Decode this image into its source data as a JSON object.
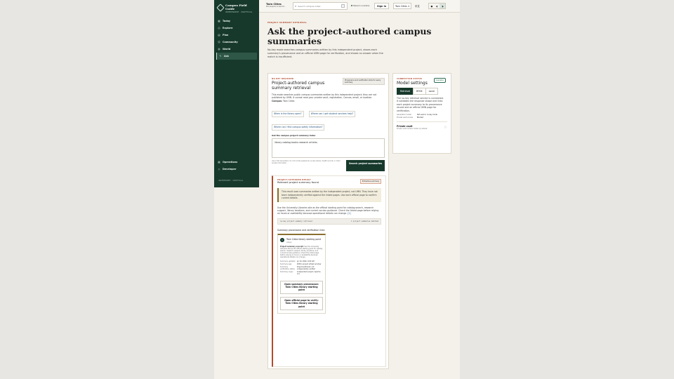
{
  "brand": {
    "name": "Campus Field Guide",
    "sub": "INDEPENDENT · UNOFFICIAL"
  },
  "nav": [
    {
      "label": "Today",
      "icon": "grid-icon"
    },
    {
      "label": "Explore",
      "icon": "compass-icon"
    },
    {
      "label": "Plan",
      "icon": "calendar-icon"
    },
    {
      "label": "Community",
      "icon": "people-icon"
    },
    {
      "label": "World",
      "icon": "globe-icon"
    },
    {
      "label": "Ask",
      "icon": "pen-icon"
    }
  ],
  "nav_secondary": [
    {
      "label": "Operations",
      "icon": "grid-icon"
    },
    {
      "label": "Developer",
      "icon": "diamond-icon"
    }
  ],
  "sidebar_footer": "INDEPENDENT · UNOFFICIAL",
  "topbar": {
    "campus_name": "Twin Cities",
    "campus_sub": "Minneapolis & Saint P...",
    "search_placeholder": "Search campus index",
    "search_kbd": "/",
    "network": "Network available",
    "sign_in": "Sign in",
    "campus_select": "Twin Cities",
    "language": "中文",
    "theme_options": [
      "●",
      "◐",
      "◑"
    ]
  },
  "page": {
    "eyebrow": "PROJECT SUMMARY RETRIEVAL",
    "title": "Ask the project-authored campus summaries",
    "lede": "No-key mode searches campus summaries written by this independent project, shows each summary's provenance and an official UMN page for verification, and shows no answer when the match is insufficient."
  },
  "retrieval": {
    "kicker": "NO KEY REQUIRED",
    "title": "Project-authored campus summary retrieval",
    "tag": "Provenance and verification links for every summary",
    "description": "This mode searches public campus summaries written by this independent project; they are not published by UMN. It cannot read your private vault, registration, Canvas, email, or location.",
    "campus_label": "Campus:",
    "campus_value": "Twin Cities",
    "suggestions": [
      "When is the library open?",
      "Where can I get student services help?",
      "Where can I find campus safety information?"
    ],
    "input_label": "Ask the campus project summary index",
    "input_value": "library catalog books research articles",
    "fineprint": "Use in ISO Generation. Do not include passwords, access tokens, health records, or other private information.",
    "submit": "Search project summaries"
  },
  "result": {
    "kicker": "PROJECT-AUTHORED RESULT",
    "title": "Relevant project summary found",
    "badge": "Extractive summary",
    "note": "This result uses summaries written by the independent project, not UMN. They have not been independently verified against the linked pages. Use each official page to confirm current details.",
    "body": "Use the University Libraries site as the official starting point for catalog search, research support, library locations, and current access guidance. Check the linked page before relying on hours or availability because operational details can change.",
    "body_link": "[1]",
    "code_left": "no-key project summary retrieval",
    "code_right": "1 project summaries matched",
    "provenance_heading": "Summary provenance and verification links",
    "source": {
      "number": "1",
      "title": "Twin Cities library starting point",
      "subtitle": "Library",
      "excerpt_label": "Project summary excerpt:",
      "excerpt": "Use the University Libraries site as the official starting point for catalog search, research support, library locations, and current access guidance. Check the linked page before relying on hours or availability because operational details can change.",
      "meta": [
        {
          "k": "Summary updated",
          "v": "Jul 10, 2026, 9:00 AM"
        },
        {
          "k": "Summary age",
          "v": "Within project refresh window"
        },
        {
          "k": "Summary verification status",
          "v": "Project-authored; not independently verified"
        },
        {
          "k": "Summary origin",
          "v": "Independent project, Apache-2.0"
        }
      ],
      "open_summary": "Open summary provenance: Twin Cities library starting point",
      "open_official": "Open official page to verify: Twin Cities library starting point"
    }
  },
  "model_settings": {
    "kicker": "CONNECTION STATUS",
    "title": "Model settings",
    "badge": "Available",
    "modes": [
      "Retrieval",
      "BYOK",
      "Local"
    ],
    "active_mode": "Retrieval",
    "description": "The no-key retrieval service is connected. It validates the response shape and links each project summary to its provenance record and an official UMN page for verification.",
    "kv": [
      {
        "k": "Generation model",
        "v": "Not used in no-key mode"
      },
      {
        "k": "Private vault access",
        "v": "Blocked"
      }
    ],
    "vault_title": "Private vault",
    "vault_desc": "Private vault remains hidden by default."
  }
}
